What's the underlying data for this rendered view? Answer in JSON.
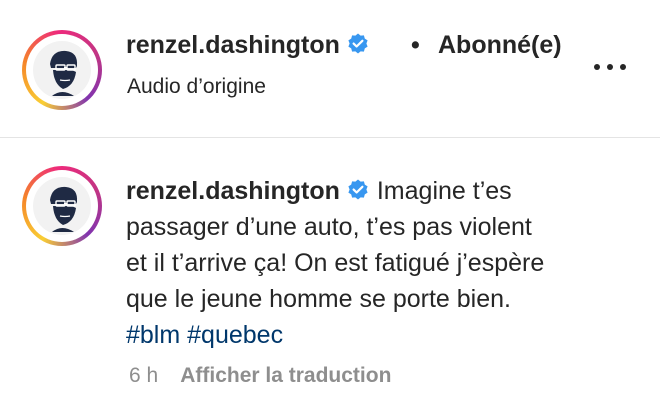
{
  "header": {
    "username": "renzel.dashington",
    "separator": "•",
    "follow_status": "Abonné(e)",
    "audio_label": "Audio d’origine",
    "verified_icon": "verified-badge-icon",
    "more_icon": "more-options-icon"
  },
  "comment": {
    "username": "renzel.dashington",
    "text": "Imagine t’es passager d’une auto, t’es pas violent et il t’arrive ça! On est fatigué j’espère que le jeune homme se porte bien.",
    "hashtags": [
      "#blm",
      "#quebec"
    ],
    "time": "6 h",
    "translate_label": "Afficher la traduction"
  },
  "colors": {
    "hashtag": "#00376b",
    "verified": "#3897f0",
    "muted_text": "#8e8e8e",
    "divider": "#e4e4e4"
  }
}
